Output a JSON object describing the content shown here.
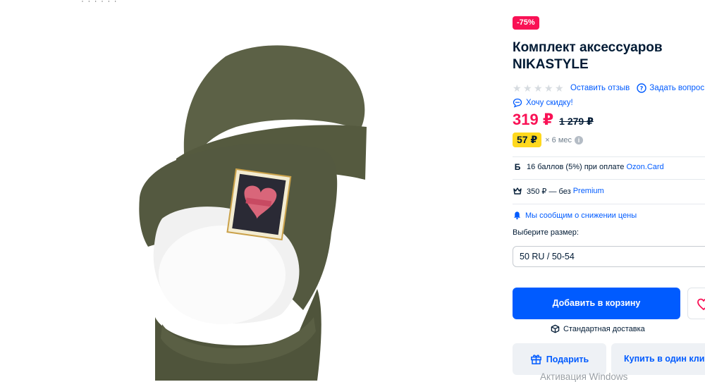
{
  "gallery": {
    "top_clip_text": "· · · · · ·",
    "image_icon": "product-photo"
  },
  "product": {
    "discount_badge": "-75%",
    "title": "Комплект аксессуаров NIKASTYLE",
    "rating": {
      "stars_filled": 0,
      "stars_total": 5,
      "review_link": "Оставить отзыв",
      "question_link": "Задать вопрос"
    },
    "want_discount": "Хочу скидку!",
    "price": "319 ₽",
    "old_price": "1 279 ₽",
    "installment": {
      "amount": "57 ₽",
      "term": "× 6 мес",
      "info_symbol": "i"
    },
    "bonus": {
      "icon": "Б",
      "text": "16 баллов (5%) при оплате ",
      "link": "Ozon.Card"
    },
    "premium": {
      "text": "350 ₽ — без ",
      "link": "Premium"
    },
    "notify": "Мы сообщим о снижении цены",
    "size_label": "Выберите размер:",
    "size_value": "50 RU / 50-54",
    "cart_button": "Добавить в корзину",
    "delivery": "Стандартная доставка",
    "gift_button": "Подарить",
    "oneclick_button": "Купить в один клик"
  },
  "system": {
    "watermark": "Активация Windows"
  },
  "colors": {
    "accent": "#005bff",
    "price": "#f91155",
    "badge": "#f91155",
    "installment": "#ffd81e"
  }
}
